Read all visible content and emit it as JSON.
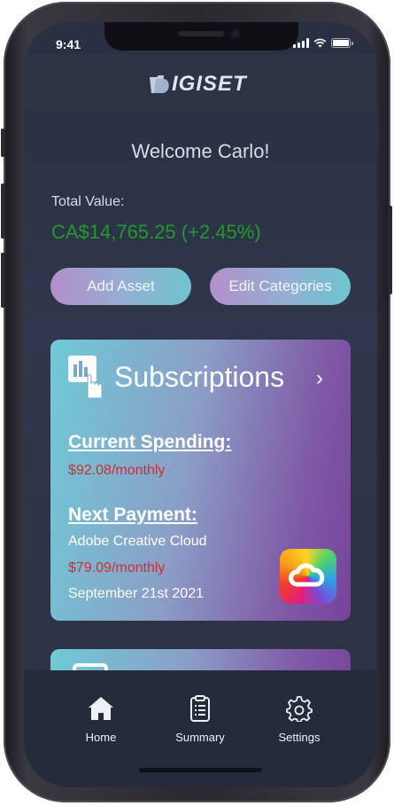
{
  "status_bar": {
    "time": "9:41"
  },
  "app": {
    "logo_text": "IGISET",
    "welcome": "Welcome Carlo!"
  },
  "portfolio": {
    "total_label": "Total Value:",
    "total_value": "CA$14,765.25 (+2.45%)",
    "value_color": "#1f9b2b"
  },
  "actions": {
    "add_asset": "Add Asset",
    "edit_categories": "Edit Categories"
  },
  "subscriptions_card": {
    "title": "Subscriptions",
    "chevron": "›",
    "current_spending_heading": "Current Spending:",
    "current_spending_value": "$92.08/monthly",
    "next_payment_heading": "Next Payment:",
    "next_payment_service": "Adobe Creative Cloud",
    "next_payment_amount": "$79.09/monthly",
    "next_payment_date": "September 21st 2021",
    "icon": "chart-touch-icon",
    "service_logo": "adobe-creative-cloud-logo"
  },
  "tabs": [
    {
      "label": "Home",
      "icon": "home-icon"
    },
    {
      "label": "Summary",
      "icon": "clipboard-icon"
    },
    {
      "label": "Settings",
      "icon": "gear-icon"
    }
  ],
  "colors": {
    "accent_red": "#d12c34",
    "background": "#2c3144"
  }
}
